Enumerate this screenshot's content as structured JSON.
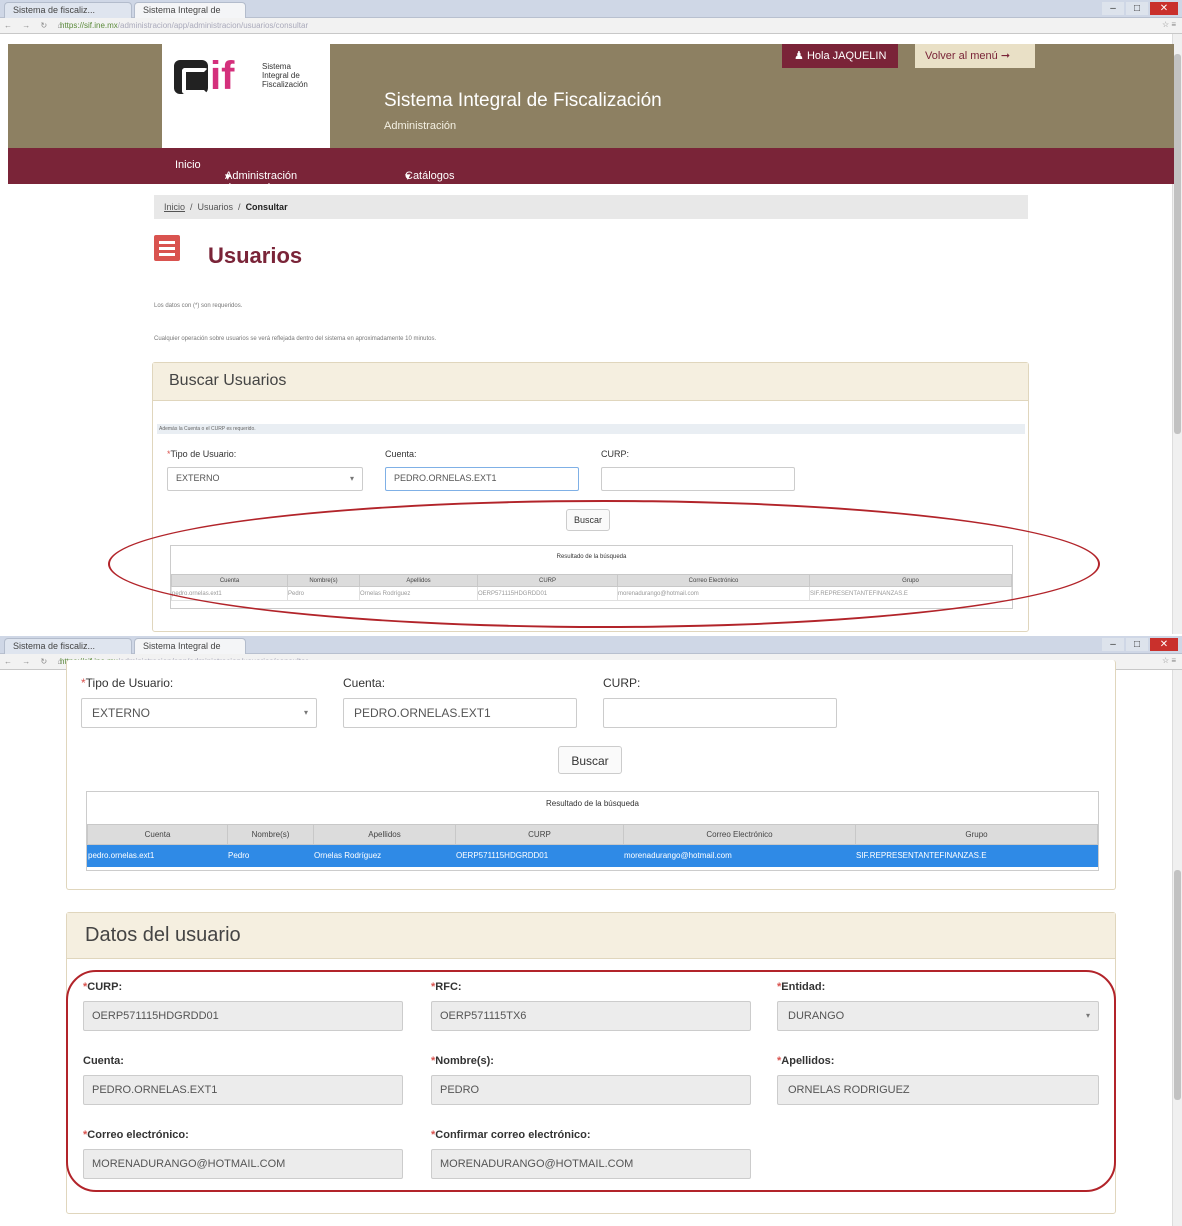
{
  "browser": {
    "tab1": "Sistema de fiscaliz...",
    "tab2": "Sistema Integral de",
    "url_host": "https://sif.ine.mx",
    "url_path": "/administracion/app/administracion/usuarios/consultar"
  },
  "header": {
    "logo_line1": "Sistema",
    "logo_line2": "Integral de",
    "logo_line3": "Fiscalización",
    "logo_if": "if",
    "title": "Sistema Integral de Fiscalización",
    "subtitle": "Administración",
    "greeting": "Hola JAQUELIN",
    "back_label": "Volver al menú"
  },
  "nav": {
    "inicio": "Inicio",
    "admin_users": "Administración de usuarios",
    "catalogs": "Catálogos"
  },
  "breadcrumb": {
    "home": "Inicio",
    "users": "Usuarios",
    "current": "Consultar"
  },
  "page": {
    "title": "Usuarios",
    "note_required": "Los datos con (*) son requeridos.",
    "note_reflected": "Cualquier operación sobre usuarios se verá reflejada dentro del sistema en aproximadamente 10 minutos."
  },
  "search": {
    "panel_title": "Buscar Usuarios",
    "hint": "Además la Cuenta o el CURP es requerido.",
    "tipo_label": "Tipo de Usuario:",
    "tipo_value": "EXTERNO",
    "cuenta_label": "Cuenta:",
    "cuenta_value": "PEDRO.ORNELAS.EXT1",
    "curp_label": "CURP:",
    "curp_value": "",
    "button": "Buscar"
  },
  "results": {
    "caption": "Resultado de la búsqueda",
    "columns": [
      "Cuenta",
      "Nombre(s)",
      "Apellidos",
      "CURP",
      "Correo Electrónico",
      "Grupo"
    ],
    "row": [
      "pedro.ornelas.ext1",
      "Pedro",
      "Ornelas Rodríguez",
      "OERP571115HDGRDD01",
      "morenadurango@hotmail.com",
      "SIF.REPRESENTANTEFINANZAS.E"
    ]
  },
  "user_data": {
    "panel_title": "Datos del usuario",
    "curp_label": "CURP:",
    "curp_value": "OERP571115HDGRDD01",
    "rfc_label": "RFC:",
    "rfc_value": "OERP571115TX6",
    "entidad_label": "Entidad:",
    "entidad_value": "DURANGO",
    "cuenta_label": "Cuenta:",
    "cuenta_value": "PEDRO.ORNELAS.EXT1",
    "nombre_label": "Nombre(s):",
    "nombre_value": "PEDRO",
    "apellidos_label": "Apellidos:",
    "apellidos_value": "ORNELAS RODRIGUEZ",
    "correo_label": "Correo electrónico:",
    "correo_value": "MORENADURANGO@HOTMAIL.COM",
    "confirm_label": "Confirmar correo electrónico:",
    "confirm_value": "MORENADURANGO@HOTMAIL.COM"
  },
  "colors": {
    "brand": "#7a2438",
    "header": "#8d8062",
    "highlight": "#b2242a",
    "selected": "#2f8ae6"
  }
}
